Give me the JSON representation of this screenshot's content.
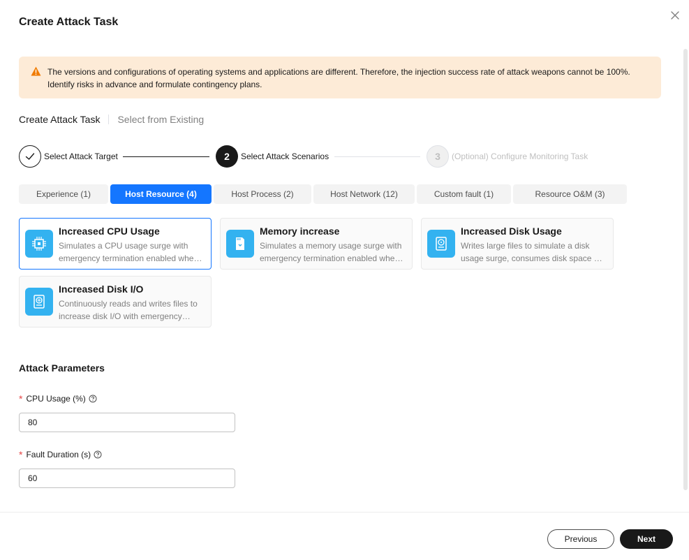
{
  "dialog": {
    "title": "Create Attack Task"
  },
  "alert": {
    "text": "The versions and configurations of operating systems and applications are different. Therefore, the injection success rate of attack weapons cannot be 100%. Identify risks in advance and formulate contingency plans."
  },
  "mode_tabs": [
    {
      "label": "Create Attack Task",
      "active": true
    },
    {
      "label": "Select from Existing",
      "active": false
    }
  ],
  "steps": [
    {
      "number": "1",
      "label": "Select Attack Target",
      "status": "done"
    },
    {
      "number": "2",
      "label": "Select Attack Scenarios",
      "status": "current"
    },
    {
      "number": "3",
      "label": "(Optional) Configure Monitoring Task",
      "status": "pending"
    }
  ],
  "category_tabs": [
    {
      "label": "Experience (1)",
      "active": false
    },
    {
      "label": "Host Resource (4)",
      "active": true
    },
    {
      "label": "Host Process (2)",
      "active": false
    },
    {
      "label": "Host Network (12)",
      "active": false
    },
    {
      "label": "Custom fault (1)",
      "active": false
    },
    {
      "label": "Resource O&M  (3)",
      "active": false
    }
  ],
  "scenarios": [
    {
      "title": "Increased CPU Usage",
      "desc": "Simulates a CPU usage surge with emergency termination enabled when the CPU usage reaches a threshold.",
      "icon": "cpu-icon",
      "selected": true
    },
    {
      "title": "Memory increase",
      "desc": "Simulates a memory usage surge with emergency termination enabled when the memory usage reaches a threshold.",
      "icon": "memory-icon",
      "selected": false
    },
    {
      "title": "Increased Disk Usage",
      "desc": "Writes large files to simulate a disk usage surge, consumes disk space by writing files.",
      "icon": "disk-icon",
      "selected": false
    },
    {
      "title": "Increased Disk I/O",
      "desc": "Continuously reads and writes files to increase disk I/O with emergency termination enabled.",
      "icon": "disk-io-icon",
      "selected": false
    }
  ],
  "params": {
    "section_title": "Attack Parameters",
    "cpu_label": "CPU Usage (%)",
    "cpu_value": "80",
    "duration_label": "Fault Duration (s)",
    "duration_value": "60"
  },
  "footer": {
    "previous_label": "Previous",
    "next_label": "Next"
  },
  "colors": {
    "accent": "#1476ff",
    "warning_bg": "#fdebd7",
    "warning_icon": "#f07b00",
    "icon_bg": "#33b2f0",
    "required": "#e54545"
  }
}
